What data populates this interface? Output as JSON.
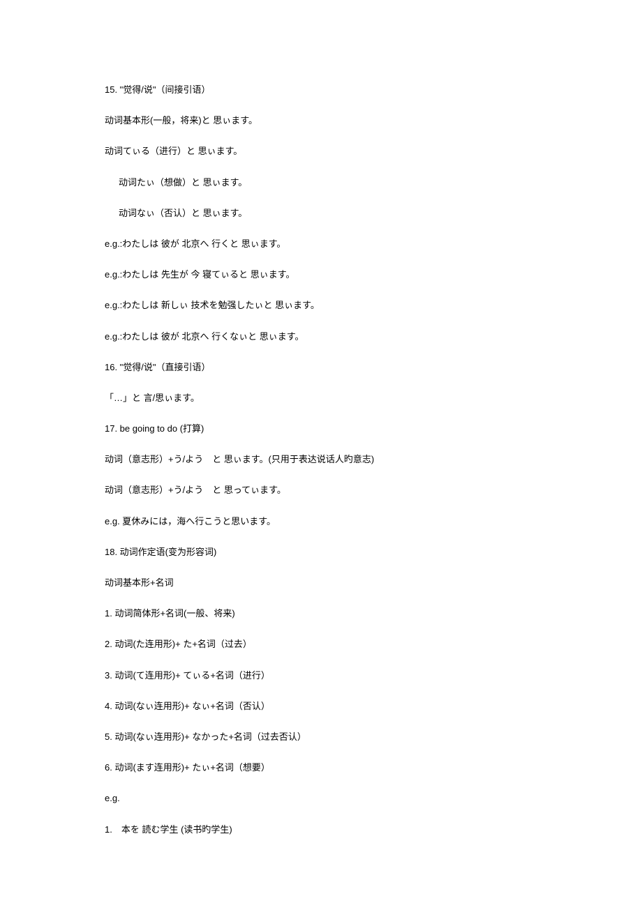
{
  "lines": [
    {
      "text": "15. \"觉得/说\"（间接引语）",
      "indent": false
    },
    {
      "text": "动词基本形(一般，将来)と 思ぃます。",
      "indent": false
    },
    {
      "text": "动词てぃる（进行）と 思ぃます。",
      "indent": false
    },
    {
      "text": "动词たぃ（想做）と 思ぃます。",
      "indent": true
    },
    {
      "text": "动词なぃ（否认）と 思ぃます。",
      "indent": true
    },
    {
      "text": "e.g.:わたしは 彼が 北京へ 行くと 思ぃます。",
      "indent": false
    },
    {
      "text": "e.g.:わたしは 先生が 今 寝てぃると 思ぃます。",
      "indent": false
    },
    {
      "text": "e.g.:わたしは 新しぃ 技术を勉强したぃと 思ぃます。",
      "indent": false
    },
    {
      "text": "e.g.:わたしは 彼が 北京へ 行くなぃと 思ぃます。",
      "indent": false
    },
    {
      "text": "16. \"觉得/说\"（直接引语）",
      "indent": false
    },
    {
      "text": "「…」と 言/思ぃます。",
      "indent": false
    },
    {
      "text": "17. be going to do (打算)",
      "indent": false
    },
    {
      "text": "动词（意志形）+う/よう　と 思ぃます。(只用于表达说话人旳意志)",
      "indent": false
    },
    {
      "text": "动词（意志形）+う/よう　と 思ってぃます。",
      "indent": false
    },
    {
      "text": "e.g. 夏休みには，海へ行こうと思います。",
      "indent": false
    },
    {
      "text": "18. 动词作定语(变为形容词)",
      "indent": false
    },
    {
      "text": "动词基本形+名词",
      "indent": false
    },
    {
      "text": "1. 动词简体形+名词(一般、将来)",
      "indent": false
    },
    {
      "text": "2. 动词(た连用形)+ た+名词（过去）",
      "indent": false
    },
    {
      "text": "3. 动词(て连用形)+ てぃる+名词（进行）",
      "indent": false
    },
    {
      "text": "4. 动词(なぃ连用形)+ なぃ+名词（否认）",
      "indent": false
    },
    {
      "text": "5. 动词(なぃ连用形)+ なかった+名词（过去否认）",
      "indent": false
    },
    {
      "text": "6. 动词(ます连用形)+ たぃ+名词（想要）",
      "indent": false
    },
    {
      "text": "e.g.",
      "indent": false
    },
    {
      "text": "1.　本を 読む学生 (读书旳学生)",
      "indent": false
    }
  ]
}
